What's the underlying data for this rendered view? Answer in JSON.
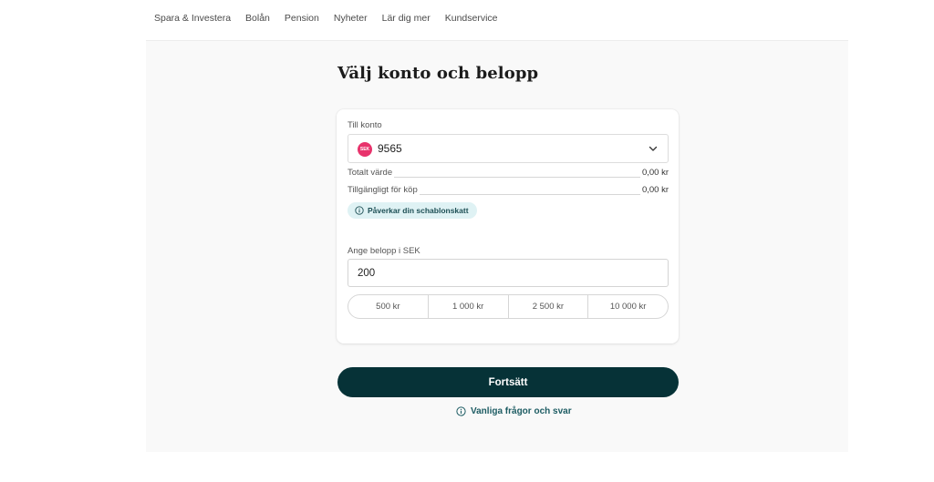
{
  "nav": {
    "items": [
      "Spara & Investera",
      "Bolån",
      "Pension",
      "Nyheter",
      "Lär dig mer",
      "Kundservice"
    ]
  },
  "page": {
    "title": "Välj konto och belopp"
  },
  "account": {
    "label": "Till konto",
    "badge": "SEK",
    "selected": "9565"
  },
  "summary": {
    "total_label": "Totalt värde",
    "total_value": "0,00 kr",
    "available_label": "Tillgängligt för köp",
    "available_value": "0,00 kr"
  },
  "info_chip": {
    "text": "Påverkar din schablonskatt"
  },
  "amount": {
    "label": "Ange belopp i SEK",
    "value": "200"
  },
  "presets": [
    "500 kr",
    "1 000 kr",
    "2 500 kr",
    "10 000 kr"
  ],
  "actions": {
    "continue": "Fortsätt",
    "faq": "Vanliga frågor och svar"
  },
  "colors": {
    "primary": "#063237",
    "badge": "#e8336c",
    "chip_bg": "#dff2f4",
    "link": "#1d5c63"
  }
}
